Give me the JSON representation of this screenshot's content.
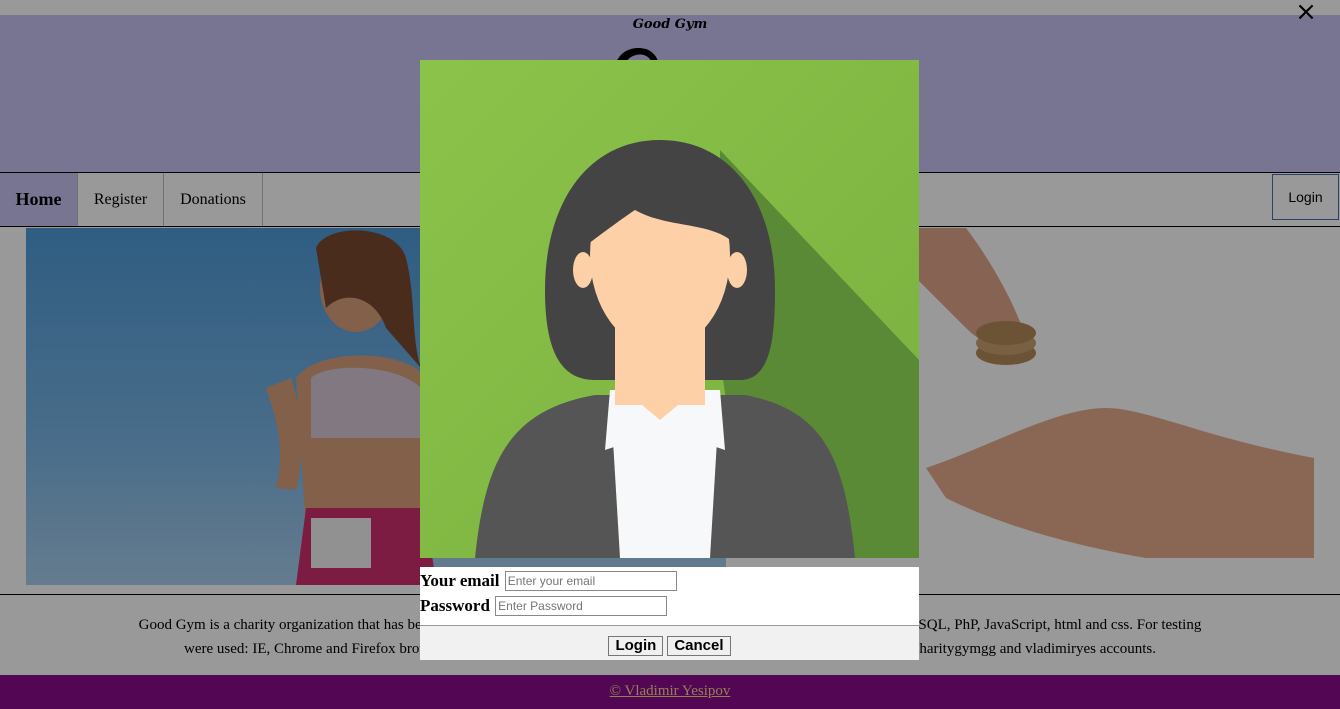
{
  "header": {
    "logo_text": "Good Gym"
  },
  "nav": {
    "items": [
      {
        "label": "Home"
      },
      {
        "label": "Register"
      },
      {
        "label": "Donations"
      }
    ],
    "login_label": "Login"
  },
  "info": {
    "line1": "Good Gym is a charity organization that has been made to impr",
    "line1_end": "web with using SQL, PhP, JavaScript, html and css. For testing",
    "line2": "were used: IE, Chrome and Firefox browse",
    "line2_end": "oodcharitygymgg and vladimiryes accounts."
  },
  "footer": {
    "copyright": "© Vladimir Yesipov"
  },
  "modal": {
    "close_icon": "×",
    "email_label": "Your email",
    "email_placeholder": "Enter your email",
    "email_value": "",
    "password_label": "Password",
    "password_placeholder": "Enter Password",
    "password_value": "",
    "login_button": "Login",
    "cancel_button": "Cancel",
    "avatar_bg_color": "#8bc34a",
    "avatar_hair_color": "#444444",
    "avatar_skin_color": "#fdd0a7",
    "avatar_suit_color": "#555555"
  }
}
